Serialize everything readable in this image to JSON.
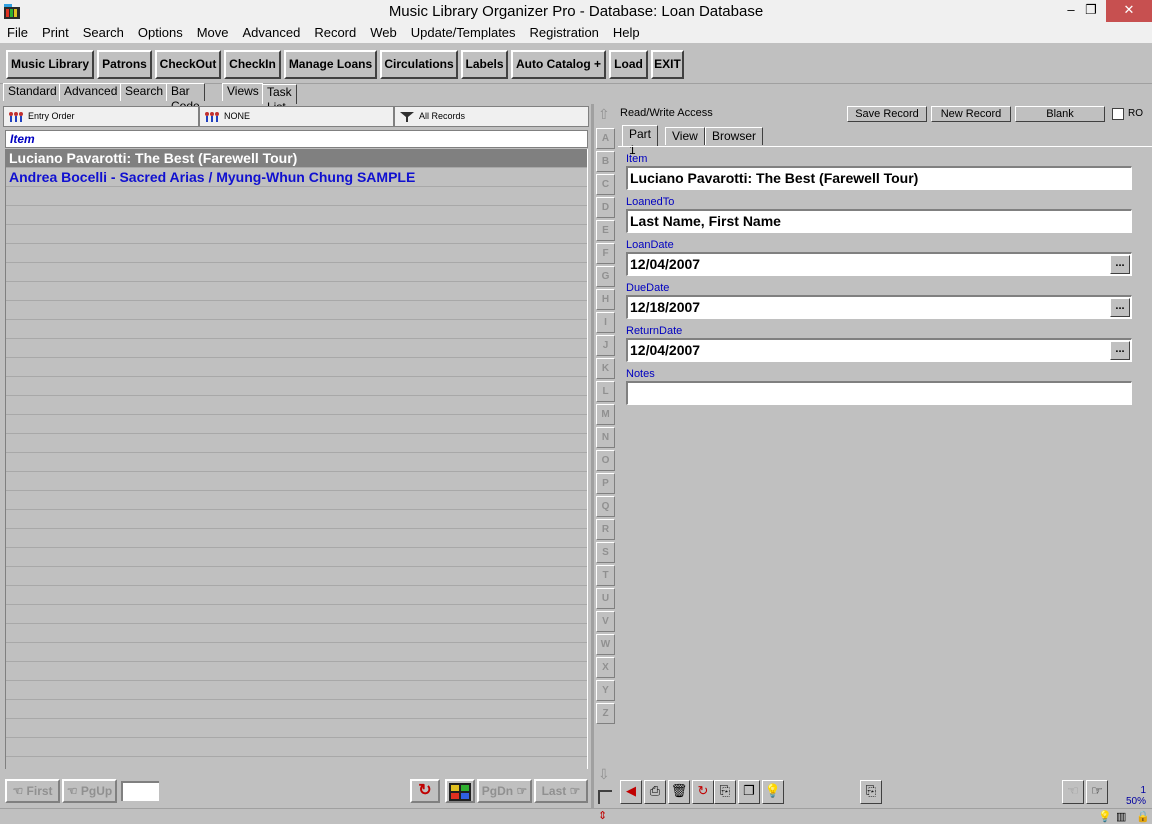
{
  "window": {
    "title": "Music Library Organizer Pro - Database: Loan Database",
    "minimize": "–",
    "restore": "❐",
    "close": "✕"
  },
  "menu": [
    "File",
    "Print",
    "Search",
    "Options",
    "Move",
    "Advanced",
    "Record",
    "Web",
    "Update/Templates",
    "Registration",
    "Help"
  ],
  "toolbar": [
    "Music Library",
    "Patrons",
    "CheckOut",
    "CheckIn",
    "Manage Loans",
    "Circulations",
    "Labels",
    "Auto Catalog +",
    "Load",
    "EXIT"
  ],
  "left_tabs": [
    "Standard",
    "Advanced",
    "Search",
    "Bar Code",
    "Views",
    "Task List"
  ],
  "filters": {
    "sort": "Entry Order",
    "filter": "NONE",
    "records": "All Records"
  },
  "list": {
    "header": "Item",
    "rows": [
      "Luciano Pavarotti: The Best (Farewell Tour)",
      "Andrea Bocelli - Sacred Arias / Myung-Whun Chung  SAMPLE"
    ]
  },
  "nav": {
    "first": "First",
    "pgup": "PgUp",
    "pgdn": "PgDn",
    "last": "Last",
    "page_value": ""
  },
  "alpha_index": [
    "A",
    "B",
    "C",
    "D",
    "E",
    "F",
    "G",
    "H",
    "I",
    "J",
    "K",
    "L",
    "M",
    "N",
    "O",
    "P",
    "Q",
    "R",
    "S",
    "T",
    "U",
    "V",
    "W",
    "X",
    "Y",
    "Z"
  ],
  "record": {
    "access": "Read/Write Access",
    "save": "Save Record",
    "new": "New Record",
    "blank": "Blank",
    "ro": "RO",
    "tabs": [
      "Part 1",
      "View",
      "Browser"
    ],
    "fields": [
      {
        "label": "Item",
        "value": "Luciano Pavarotti: The Best (Farewell Tour)",
        "picker": false
      },
      {
        "label": "LoanedTo",
        "value": "Last Name, First Name",
        "picker": false
      },
      {
        "label": "LoanDate",
        "value": "12/04/2007",
        "picker": true
      },
      {
        "label": "DueDate",
        "value": "12/18/2007",
        "picker": true
      },
      {
        "label": "ReturnDate",
        "value": "12/04/2007",
        "picker": true
      },
      {
        "label": "Notes",
        "value": "",
        "picker": false
      }
    ],
    "picker_label": "..."
  },
  "status": {
    "record_num": "1",
    "zoom": "50%"
  },
  "colors": {
    "list_link": "#1010d0",
    "selected_row": "#808080",
    "label_blue": "#0000c0"
  }
}
